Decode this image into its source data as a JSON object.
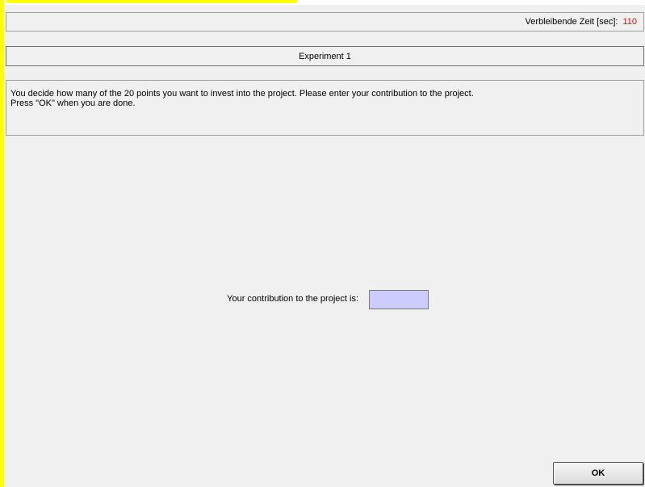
{
  "timer": {
    "label": "Verbleibende Zeit [sec]:",
    "value": "110"
  },
  "header": {
    "title": "Experiment 1"
  },
  "instructions": {
    "line1": "You decide how many of the 20 points you want to invest into the project. Please enter your contribution to the project.",
    "line2": "Press \"OK\" when you are done."
  },
  "contribution": {
    "label": "Your contribution to the project is:",
    "value": ""
  },
  "actions": {
    "ok_label": "OK"
  },
  "colors": {
    "timer_value": "#ff0000",
    "input_background": "#ccccff",
    "side_bar": "#ffff00",
    "panel_background": "#f0f0f0"
  }
}
